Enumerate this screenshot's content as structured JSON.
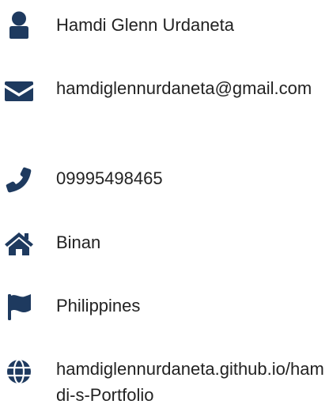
{
  "contact": {
    "name": "Hamdi Glenn Urdaneta",
    "email": "hamdiglennurdaneta@gmail.com",
    "phone": "09995498465",
    "city": "Binan",
    "country": "Philippines",
    "website": "hamdiglennurdaneta.github.io/hamdi-s-Portfolio"
  },
  "icons": {
    "name": "user-icon",
    "email": "envelope-icon",
    "phone": "phone-icon",
    "city": "home-icon",
    "country": "flag-icon",
    "website": "globe-icon"
  },
  "colors": {
    "icon": "#1e3a5f",
    "text": "#222222",
    "background": "#ffffff"
  }
}
